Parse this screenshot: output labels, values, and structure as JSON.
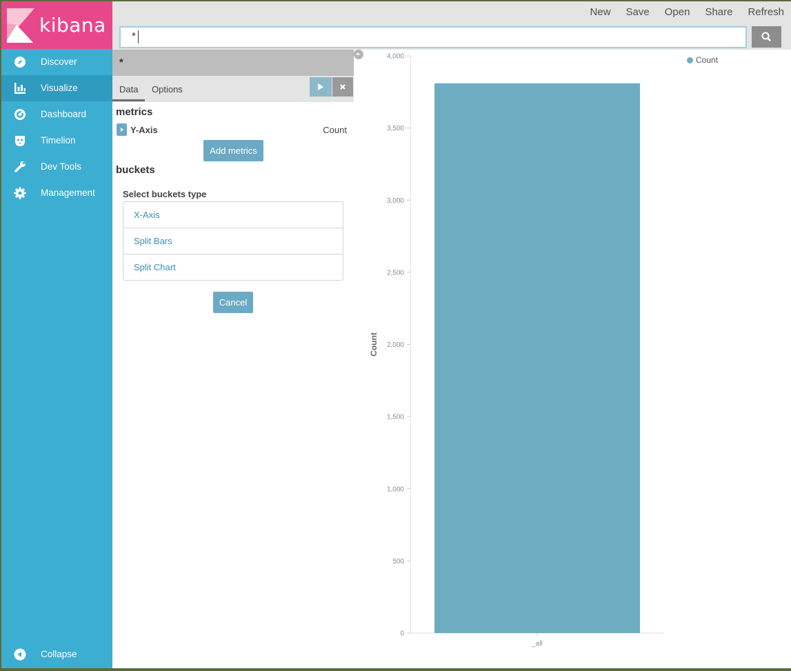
{
  "app": {
    "name": "kibana"
  },
  "sidebar": {
    "items": [
      {
        "label": "Discover",
        "icon": "compass-icon"
      },
      {
        "label": "Visualize",
        "icon": "bar-chart-icon",
        "active": true
      },
      {
        "label": "Dashboard",
        "icon": "dashboard-icon"
      },
      {
        "label": "Timelion",
        "icon": "timelion-icon"
      },
      {
        "label": "Dev Tools",
        "icon": "wrench-icon"
      },
      {
        "label": "Management",
        "icon": "gear-icon"
      }
    ],
    "collapse_label": "Collapse"
  },
  "topbar": {
    "menu": [
      "New",
      "Save",
      "Open",
      "Share",
      "Refresh"
    ],
    "search": {
      "value": "*"
    }
  },
  "editor": {
    "index_pattern": "*",
    "tabs": [
      "Data",
      "Options"
    ],
    "metrics_title": "metrics",
    "y_axis_label": "Y-Axis",
    "y_axis_value": "Count",
    "add_metrics_label": "Add metrics",
    "buckets_title": "buckets",
    "buckets_type_label": "Select buckets type",
    "bucket_types": [
      "X-Axis",
      "Split Bars",
      "Split Chart"
    ],
    "cancel_label": "Cancel"
  },
  "colors": {
    "sidebar": "#3caed2",
    "logo": "#e8488b",
    "accent": "#6ba9c4",
    "bar": "#6eadc1"
  },
  "chart_data": {
    "type": "bar",
    "categories": [
      "_all"
    ],
    "series": [
      {
        "name": "Count",
        "values": [
          3810
        ]
      }
    ],
    "title": "",
    "xlabel": "",
    "ylabel": "Count",
    "ylim": [
      0,
      4000
    ],
    "yticks": [
      0,
      500,
      1000,
      1500,
      2000,
      2500,
      3000,
      3500,
      4000
    ],
    "ytick_labels": [
      "0",
      "500",
      "1,000",
      "1,500",
      "2,000",
      "2,500",
      "3,000",
      "3,500",
      "4,000"
    ],
    "legend": {
      "position": "top-right",
      "entries": [
        "Count"
      ]
    },
    "grid": false
  }
}
